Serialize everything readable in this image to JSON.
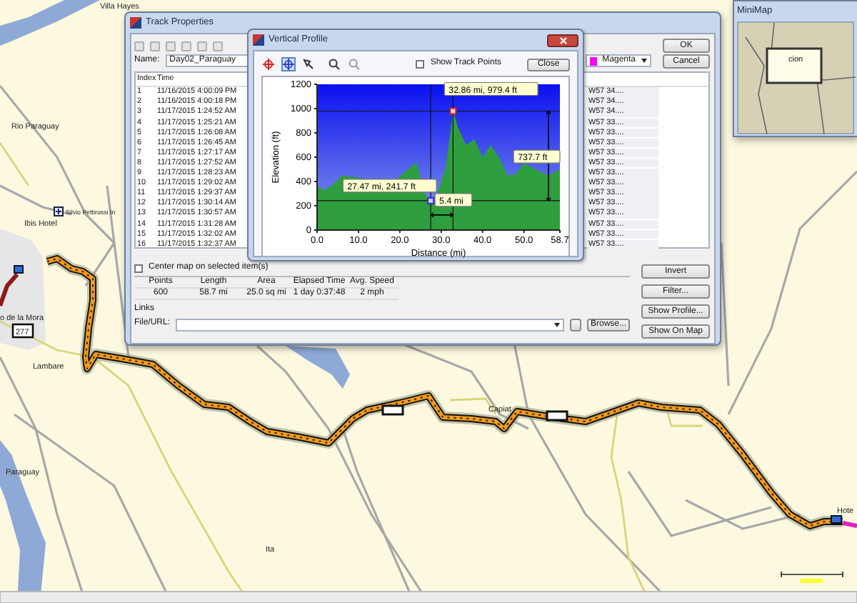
{
  "map": {
    "place_labels": [
      "Villa Hayes",
      "Rio Paraguay",
      "Silvio Pettirossi In",
      "Ibis Hotel",
      "o de la Mora",
      "Lambare",
      "Paraguay",
      "Capiat",
      "Ita",
      "Hote"
    ],
    "route_shields": [
      "277"
    ]
  },
  "minimap": {
    "title": "MiniMap",
    "label": "cion"
  },
  "track_properties": {
    "title": "Track Properties",
    "name_label": "Name:",
    "name_value": "Day02_Paraguay",
    "color": {
      "label": "Magenta",
      "color": "#ff00ff"
    },
    "buttons": [
      "OK",
      "Cancel"
    ],
    "columns": [
      "Index",
      "Time"
    ],
    "rows": [
      {
        "index": "1",
        "time": "11/16/2015 4:00:09 PM",
        "position": "W57 34...."
      },
      {
        "index": "2",
        "time": "11/16/2015 4:00:18 PM",
        "position": "W57 34...."
      },
      {
        "index": "3",
        "time": "11/17/2015 1:24:52 AM",
        "position": "W57 34...."
      },
      {
        "index": "4",
        "time": "11/17/2015 1:25:21 AM",
        "position": "W57 33...."
      },
      {
        "index": "5",
        "time": "11/17/2015 1:26:08 AM",
        "position": "W57 33...."
      },
      {
        "index": "6",
        "time": "11/17/2015 1:26:45 AM",
        "position": "W57 33...."
      },
      {
        "index": "7",
        "time": "11/17/2015 1:27:17 AM",
        "position": "W57 33...."
      },
      {
        "index": "8",
        "time": "11/17/2015 1:27:52 AM",
        "position": "W57 33...."
      },
      {
        "index": "9",
        "time": "11/17/2015 1:28:23 AM",
        "position": "W57 33...."
      },
      {
        "index": "10",
        "time": "11/17/2015 1:29:02 AM",
        "position": "W57 33...."
      },
      {
        "index": "11",
        "time": "11/17/2015 1:29:37 AM",
        "position": "W57 33...."
      },
      {
        "index": "12",
        "time": "11/17/2015 1:30:14 AM",
        "position": "W57 33...."
      },
      {
        "index": "13",
        "time": "11/17/2015 1:30:57 AM",
        "position": "W57 33...."
      },
      {
        "index": "14",
        "time": "11/17/2015 1:31:28 AM",
        "position": "W57 33...."
      },
      {
        "index": "15",
        "time": "11/17/2015 1:32:02 AM",
        "position": "W57 33...."
      },
      {
        "index": "16",
        "time": "11/17/2015 1:32:37 AM",
        "position": "W57 33...."
      }
    ],
    "center_map": {
      "label": "Center map on selected item(s)",
      "checked": false
    },
    "stats": {
      "columns": [
        "Points",
        "Length",
        "Area",
        "Elapsed Time",
        "Avg. Speed"
      ],
      "values": [
        "600",
        "58.7 mi",
        "25.0 sq mi",
        "1 day 0:37:48",
        "2 mph"
      ]
    },
    "links_label": "Links",
    "file_url_label": "File/URL:",
    "browse": "Browse...",
    "side_buttons": [
      "Invert",
      "Filter...",
      "Show Profile...",
      "Show On Map"
    ]
  },
  "vertical_profile": {
    "title": "Vertical Profile",
    "tools": [
      {
        "kind": "target",
        "selected": false
      },
      {
        "kind": "pan",
        "selected": true
      },
      {
        "kind": "select",
        "selected": false
      },
      {
        "kind": "zoom-in",
        "selected": false
      },
      {
        "kind": "zoom-out",
        "selected": false
      }
    ],
    "show_track_points": {
      "label": "Show Track Points",
      "checked": false
    },
    "close": "Close",
    "measurements": {
      "distance": "5.4 mi",
      "rise": "737.7 ft"
    },
    "chart_data": {
      "type": "area",
      "xlabel": "Distance (mi)",
      "ylabel": "Elevation (ft)",
      "x": [
        0,
        2,
        4,
        6,
        12,
        16,
        24,
        26,
        27.5,
        29,
        31,
        32.9,
        34,
        36,
        38,
        40,
        42,
        44,
        46,
        48,
        50,
        54,
        56,
        58.7
      ],
      "series": [
        {
          "color": "#2e9e3e",
          "values": [
            360,
            330,
            380,
            450,
            420,
            320,
            560,
            300,
            240,
            300,
            500,
            980,
            850,
            700,
            750,
            600,
            700,
            600,
            450,
            460,
            550,
            480,
            450,
            500
          ]
        }
      ],
      "xlim": [
        0,
        58.7
      ],
      "ylim": [
        0,
        1200
      ],
      "xticks": [
        {
          "value": 0,
          "label": "0.0"
        },
        {
          "value": 10,
          "label": "10.0"
        },
        {
          "value": 20,
          "label": "20.0"
        },
        {
          "value": 30,
          "label": "30.0"
        },
        {
          "value": 40,
          "label": "40.0"
        },
        {
          "value": 50,
          "label": "50.0"
        },
        {
          "value": 58.7,
          "label": "58.7"
        }
      ],
      "yticks": [
        0,
        200,
        400,
        600,
        800,
        1000,
        1200
      ],
      "ref_lines": [
        {
          "axis": "x",
          "value": 27.47
        },
        {
          "axis": "x",
          "value": 32.86
        },
        {
          "axis": "y",
          "value": 241.7
        },
        {
          "axis": "y",
          "value": 979.4
        }
      ],
      "annotations": [
        {
          "x": 32.86,
          "y": 979.4,
          "text": "32.86 mi, 979.4 ft"
        },
        {
          "x": 27.47,
          "y": 241.7,
          "text": "27.47 mi, 241.7 ft"
        }
      ]
    }
  }
}
